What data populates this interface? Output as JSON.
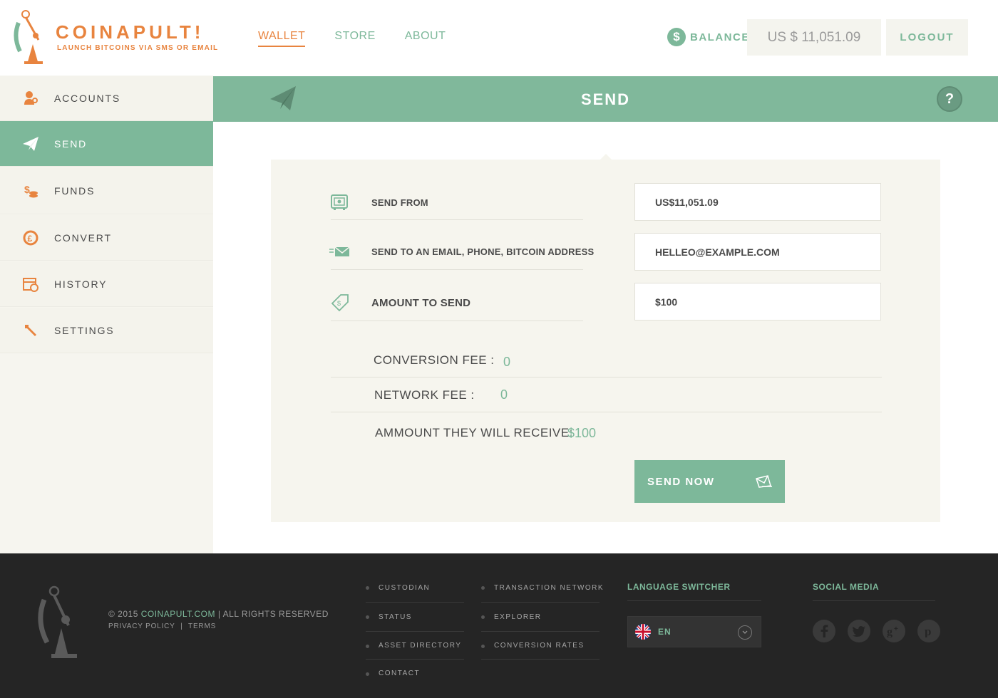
{
  "header": {
    "logo_title": "COINAPULT!",
    "logo_tagline": "LAUNCH BITCOINS VIA SMS OR EMAIL",
    "nav": [
      {
        "label": "WALLET",
        "active": true
      },
      {
        "label": "STORE",
        "active": false
      },
      {
        "label": "ABOUT",
        "active": false
      }
    ],
    "balance_symbol": "$",
    "balance_label": "BALANCE",
    "balance_value": "US $ 11,051.09",
    "logout_label": "LOGOUT"
  },
  "sidebar": {
    "items": [
      {
        "label": "ACCOUNTS",
        "icon": "accounts-icon"
      },
      {
        "label": "SEND",
        "icon": "paper-plane-icon",
        "active": true
      },
      {
        "label": "FUNDS",
        "icon": "coins-icon"
      },
      {
        "label": "CONVERT",
        "icon": "convert-icon"
      },
      {
        "label": "HISTORY",
        "icon": "calendar-icon"
      },
      {
        "label": "SETTINGS",
        "icon": "wrench-icon"
      }
    ]
  },
  "main": {
    "title": "SEND",
    "help_label": "?",
    "form": {
      "send_from_label": "SEND FROM",
      "send_from_value": "US$11,051.09",
      "send_to_label": "SEND TO AN EMAIL, PHONE, BITCOIN ADDRESS",
      "send_to_value": "HELLEO@EXAMPLE.COM",
      "amount_label": "AMOUNT TO SEND",
      "amount_value": "$100"
    },
    "fees": {
      "conversion_label": "CONVERSION FEE :",
      "conversion_value": "0",
      "network_label": "NETWORK FEE :",
      "network_value": "0",
      "receive_label": "AMMOUNT THEY WILL RECEIVE:",
      "receive_value": "$100"
    },
    "send_now_label": "SEND NOW"
  },
  "footer": {
    "copyright_prefix": "© 2015",
    "copyright_brand": "COINAPULT.COM",
    "copyright_suffix": "| ALL RIGHTS RESERVED",
    "privacy_label": "PRIVACY POLICY",
    "separator": "|",
    "terms_label": "TERMS",
    "links_col1": [
      "CUSTODIAN",
      "STATUS",
      "ASSET DIRECTORY",
      "CONTACT"
    ],
    "links_col2": [
      "TRANSACTION NETWORK",
      "EXPLORER",
      "CONVERSION RATES"
    ],
    "language_heading": "LANGUAGE SWITCHER",
    "language_value": "EN",
    "social_heading": "SOCIAL MEDIA",
    "socials": [
      "facebook-icon",
      "twitter-icon",
      "google-plus-icon",
      "pinterest-icon"
    ]
  },
  "colors": {
    "accent_green": "#7db89a",
    "accent_orange": "#e8843f",
    "footer_bg": "#252525"
  }
}
